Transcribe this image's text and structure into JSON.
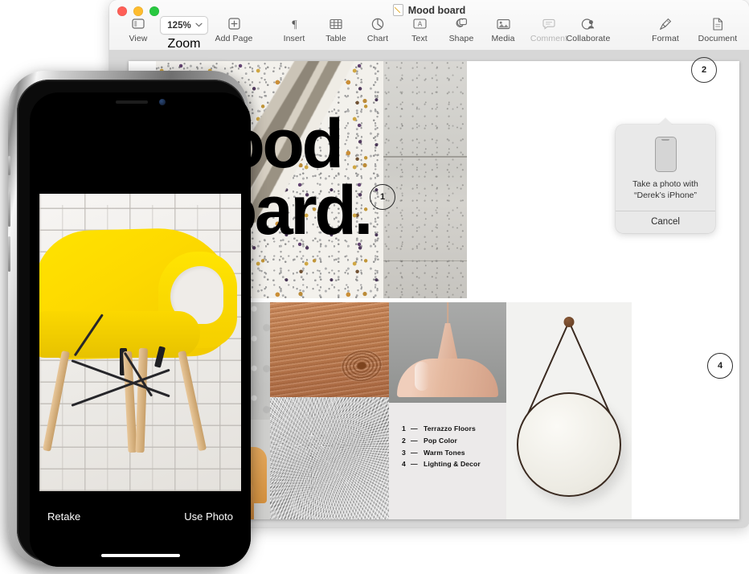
{
  "window": {
    "title": "Mood board",
    "traffic_lights": [
      "close-button",
      "minimize-button",
      "zoom-button"
    ]
  },
  "toolbar": {
    "left": [
      {
        "label": "View",
        "icon": "sidebar-icon",
        "disabled": false
      },
      {
        "label": "Zoom",
        "icon": "zoom-popup",
        "value": "125%",
        "chevron": "∨",
        "disabled": false
      },
      {
        "label": "Add Page",
        "icon": "plus-box-icon",
        "disabled": false
      }
    ],
    "center": [
      {
        "label": "Insert",
        "icon": "pilcrow-icon",
        "disabled": false
      },
      {
        "label": "Table",
        "icon": "table-icon",
        "disabled": false
      },
      {
        "label": "Chart",
        "icon": "chart-pie-icon",
        "disabled": false
      },
      {
        "label": "Text",
        "icon": "text-box-icon",
        "disabled": false
      },
      {
        "label": "Shape",
        "icon": "shape-icon",
        "disabled": false
      },
      {
        "label": "Media",
        "icon": "media-image-icon",
        "disabled": false
      },
      {
        "label": "Comment",
        "icon": "comment-bubble-icon",
        "disabled": true
      }
    ],
    "collaborate": {
      "label": "Collaborate",
      "icon": "collaborate-person-icon",
      "disabled": false
    },
    "right": [
      {
        "label": "Format",
        "icon": "paintbrush-icon",
        "disabled": false
      },
      {
        "label": "Document",
        "icon": "document-page-icon",
        "disabled": false
      }
    ]
  },
  "document": {
    "headline_line1": "Mood",
    "headline_line2": "Board.",
    "list": [
      {
        "number": "1",
        "dash": "—",
        "label": "Terrazzo Floors"
      },
      {
        "number": "2",
        "dash": "—",
        "label": "Pop Color"
      },
      {
        "number": "3",
        "dash": "—",
        "label": "Warm Tones"
      },
      {
        "number": "4",
        "dash": "—",
        "label": "Lighting & Decor"
      }
    ],
    "badges": [
      {
        "id": "badge-1",
        "text": "1"
      },
      {
        "id": "badge-2",
        "text": "2"
      },
      {
        "id": "badge-4",
        "text": "4"
      }
    ],
    "images": [
      {
        "name": "terrazzo-slab-photo"
      },
      {
        "name": "concrete-wall-photo"
      },
      {
        "name": "grey-plaster-photo"
      },
      {
        "name": "tan-leather-sofa-photo"
      },
      {
        "name": "wood-grain-photo"
      },
      {
        "name": "grey-fur-rug-photo"
      },
      {
        "name": "copper-pendant-lamp-photo"
      },
      {
        "name": "round-hanging-mirror-photo"
      }
    ]
  },
  "popover": {
    "message_line1": "Take a photo with",
    "message_line2": "“Derek’s iPhone”",
    "cancel_label": "Cancel",
    "device_icon": "iphone-icon"
  },
  "iphone": {
    "retake_label": "Retake",
    "use_photo_label": "Use Photo",
    "photo_subject": "yellow-eames-armchair-photo"
  },
  "colors": {
    "window_chrome": "#f3f3f3",
    "canvas_background": "#d7d7d7",
    "page_background": "#ffffff",
    "popover_background": "#e9e9e9",
    "headline_text": "#000000",
    "chair_yellow": "#ffe300",
    "traffic_red": "#ff5f57",
    "traffic_yellow": "#febc2e",
    "traffic_green": "#28c840"
  }
}
